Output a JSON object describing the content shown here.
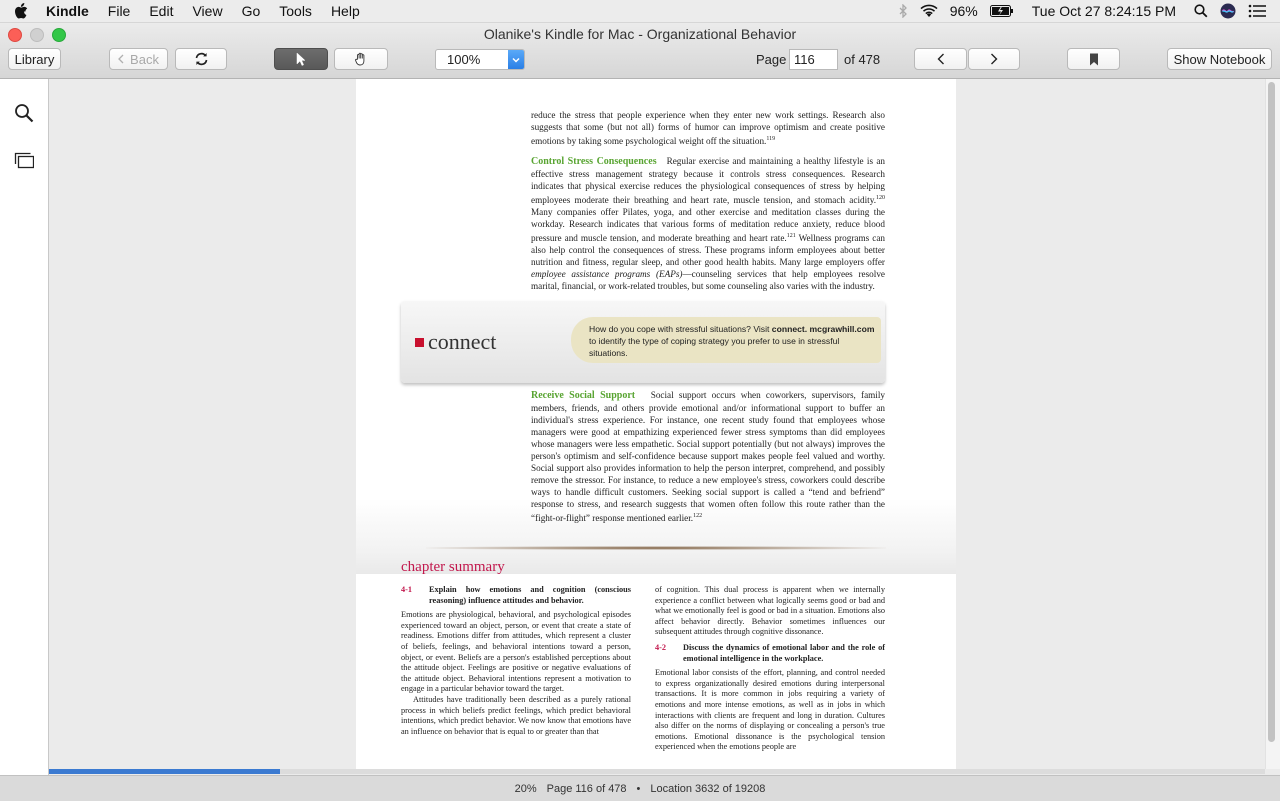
{
  "menubar": {
    "app_name": "Kindle",
    "menus": [
      "File",
      "Edit",
      "View",
      "Go",
      "Tools",
      "Help"
    ],
    "battery": "96%",
    "clock": "Tue Oct 27  8:24:15 PM"
  },
  "window": {
    "title": "Olanike's Kindle for Mac - Organizational Behavior"
  },
  "toolbar": {
    "library_label": "Library",
    "back_label": "Back",
    "zoom_value": "100%",
    "page_label": "Page",
    "page_value": "116",
    "page_total": "of 478",
    "notebook_label": "Show Notebook"
  },
  "book_page": {
    "para1": "reduce the stress that people experience when they enter new work settings. Research also suggests that some (but not all) forms of humor can improve optimism and create positive emotions by taking some psychological weight off the situation.",
    "para1_note": "119",
    "control_heading": "Control Stress Consequences",
    "control_a": "Regular exercise and maintaining a healthy lifestyle is an effective stress management strategy because it controls stress consequences. Research indicates that physical exercise reduces the physiological consequences of stress by helping employees moderate their breathing and heart rate, muscle tension, and stomach acidity.",
    "control_note1": "120",
    "control_b": " Many companies offer Pilates, yoga, and other exercise and meditation classes during the workday. Research indicates that various forms of meditation reduce anxiety, reduce blood pressure and muscle tension, and moderate breathing and heart rate.",
    "control_note2": "121",
    "control_c": " Wellness programs can also help control the consequences of stress. These programs inform employees about better nutrition and fitness, regular sleep, and other good health habits. Many large employers offer ",
    "control_italic": "employee assistance programs (EAPs)",
    "control_d": "—counseling services that help employees resolve marital, financial, or work-related troubles, but some counseling also varies with the industry.",
    "connect_logo": "connect",
    "connect_text_a": "How do you cope with stressful situations? Visit ",
    "connect_text_url": "connect. mcgrawhill.com",
    "connect_text_b": " to identify the type of coping strategy you prefer to use in stressful situations.",
    "social_heading": "Receive Social Support",
    "social_text": "Social support occurs when coworkers, supervisors, family members, friends, and others provide emotional and/or informational support to buffer an individual's stress experience. For instance, one recent study found that employees whose managers were good at empathizing experienced fewer stress symptoms than did employees whose managers were less empathetic. Social support potentially (but not always) improves the person's optimism and self-confidence because support makes people feel valued and worthy. Social support also provides information to help the person interpret, comprehend, and possibly remove the stressor. For instance, to reduce a new employee's stress, coworkers could describe ways to handle difficult customers. Seeking social support is called a “tend and befriend” response to stress, and research suggests that women often follow this route rather than the “fight-or-flight” response mentioned earlier.",
    "social_note": "122",
    "chapter_heading": "chapter summary",
    "s1_num": "4-1",
    "s1_head": "Explain how emotions and cognition (conscious reasoning) influence attitudes and behavior.",
    "s1_text": "Emotions are physiological, behavioral, and psychological episodes experienced toward an object, person, or event that create a state of readiness. Emotions differ from attitudes, which represent a cluster of beliefs, feelings, and behavioral intentions toward a person, object, or event. Beliefs are a person's established perceptions about the attitude object. Feelings are positive or negative evaluations of the attitude object. Behavioral intentions represent a motivation to engage in a particular behavior toward the target.",
    "s1_text2": "Attitudes have traditionally been described as a purely rational process in which beliefs predict feelings, which predict behavioral intentions, which predict behavior. We now know that emotions have an influence on behavior that is equal to or greater than that",
    "s1_cont": "of cognition. This dual process is apparent when we internally experience a conflict between what logically seems good or bad and what we emotionally feel is good or bad in a situation. Emotions also affect behavior directly. Behavior sometimes influences our subsequent attitudes through cognitive dissonance.",
    "s2_num": "4-2",
    "s2_head": "Discuss the dynamics of emotional labor and the role of emotional intelligence in the workplace.",
    "s2_text": "Emotional labor consists of the effort, planning, and control needed to express organizationally desired emotions during interpersonal transactions. It is more common in jobs requiring a variety of emotions and more intense emotions, as well as in jobs in which interactions with clients are frequent and long in duration. Cultures also differ on the norms of displaying or concealing a person's true emotions. Emotional dissonance is the psychological tension experienced when the emotions people are"
  },
  "status": {
    "percent": "20%",
    "page": "Page 116 of 478",
    "bullet": "•",
    "location": "Location 3632 of 19208",
    "progress": 0.19
  },
  "icons": [
    "apple-icon",
    "bluetooth-icon",
    "wifi-icon",
    "battery-icon",
    "spotlight-icon",
    "siri-icon",
    "list-icon",
    "sync-icon",
    "select-cursor-icon",
    "hand-tool-icon",
    "chevron-left-icon",
    "chevron-right-icon",
    "bookmark-icon",
    "search-icon",
    "flashcards-icon"
  ],
  "colors": {
    "accent_blue": "#3b7ad1",
    "heading_green": "#58a431",
    "chapter_red": "#c2184d"
  }
}
